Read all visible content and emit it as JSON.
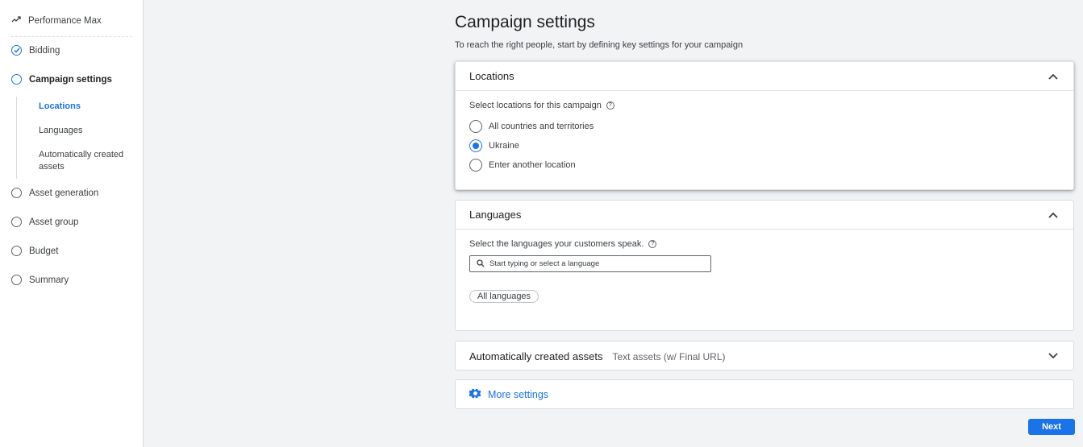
{
  "sidebar": {
    "top": {
      "label": "Performance Max",
      "icon": "trend-line-icon"
    },
    "items": [
      {
        "label": "Bidding",
        "state": "completed"
      },
      {
        "label": "Campaign settings",
        "state": "active"
      },
      {
        "label": "Asset generation",
        "state": "todo"
      },
      {
        "label": "Asset group",
        "state": "todo"
      },
      {
        "label": "Budget",
        "state": "todo"
      },
      {
        "label": "Summary",
        "state": "todo"
      }
    ],
    "sub_items": [
      {
        "label": "Locations",
        "active": true
      },
      {
        "label": "Languages",
        "active": false
      },
      {
        "label": "Automatically created assets",
        "active": false
      }
    ]
  },
  "main": {
    "title": "Campaign settings",
    "subtitle": "To reach the right people, start by defining key settings for your campaign",
    "locations": {
      "title": "Locations",
      "prompt": "Select locations for this campaign",
      "options": [
        {
          "label": "All countries and territories",
          "selected": false
        },
        {
          "label": "Ukraine",
          "selected": true
        },
        {
          "label": "Enter another location",
          "selected": false
        }
      ]
    },
    "languages": {
      "title": "Languages",
      "prompt": "Select the languages your customers speak.",
      "search_placeholder": "Start typing or select a language",
      "chip": "All languages"
    },
    "auto_assets": {
      "title": "Automatically created assets",
      "summary": "Text assets (w/ Final URL)"
    },
    "more_settings": {
      "label": "More settings"
    },
    "next_button": "Next"
  },
  "colors": {
    "accent": "#1a73e8",
    "background": "#f1f3f4",
    "text": "#3c4043"
  }
}
